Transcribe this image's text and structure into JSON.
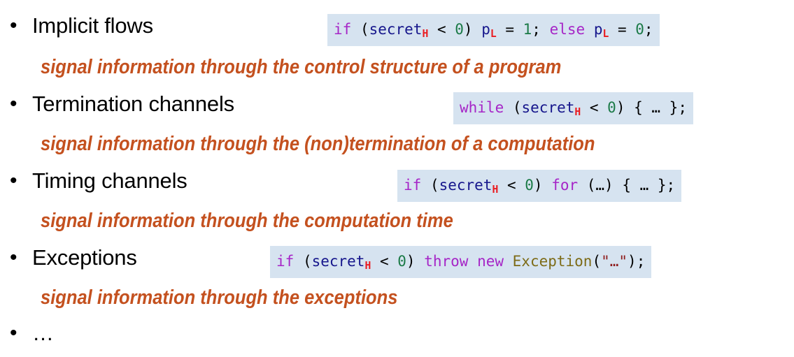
{
  "slide": {
    "background_color": "#ffffff",
    "bullet_glyph": "•",
    "text_color": "#000000",
    "description_color": "#c4511f",
    "code_highlight_color": "#d6e3f0",
    "syntax_colors": {
      "keyword": "#a626c7",
      "identifier": "#16168c",
      "number": "#1b7a47",
      "class": "#7d6b17",
      "string": "#8e1b1b",
      "subscript": "#ea1c21",
      "punctuation": "#000000"
    }
  },
  "bullets": [
    {
      "label": "Implicit flows",
      "description": "signal information through the control structure of a program",
      "code_plain": "if (secretH < 0) pL = 1; else pL = 0;"
    },
    {
      "label": "Termination channels",
      "description": "signal information through the (non)termination of a computation",
      "code_plain": "while (secretH < 0) { … };"
    },
    {
      "label": "Timing channels",
      "description": "signal information through the computation time",
      "code_plain": "if (secretH < 0) for (…) { … };"
    },
    {
      "label": "Exceptions",
      "description": "signal information through the exceptions",
      "code_plain": "if (secretH < 0) throw new Exception(\"…\");"
    },
    {
      "label": "…",
      "description": "",
      "code_plain": ""
    }
  ],
  "code_tokens": {
    "implicit_flows": [
      {
        "t": "if",
        "c": "kw"
      },
      {
        "t": " (",
        "c": "pun"
      },
      {
        "t": "secret",
        "c": "id",
        "sub": "H"
      },
      {
        "t": " < ",
        "c": "pun"
      },
      {
        "t": "0",
        "c": "num"
      },
      {
        "t": ") ",
        "c": "pun"
      },
      {
        "t": "p",
        "c": "id",
        "sub": "L"
      },
      {
        "t": " = ",
        "c": "pun"
      },
      {
        "t": "1",
        "c": "num"
      },
      {
        "t": "; ",
        "c": "pun"
      },
      {
        "t": "else",
        "c": "kw"
      },
      {
        "t": " ",
        "c": "pun"
      },
      {
        "t": "p",
        "c": "id",
        "sub": "L"
      },
      {
        "t": " = ",
        "c": "pun"
      },
      {
        "t": "0",
        "c": "num"
      },
      {
        "t": ";",
        "c": "pun"
      }
    ],
    "termination_channels": [
      {
        "t": "while",
        "c": "kw"
      },
      {
        "t": " (",
        "c": "pun"
      },
      {
        "t": "secret",
        "c": "id",
        "sub": "H"
      },
      {
        "t": " < ",
        "c": "pun"
      },
      {
        "t": "0",
        "c": "num"
      },
      {
        "t": ") { … };",
        "c": "pun"
      }
    ],
    "timing_channels": [
      {
        "t": "if",
        "c": "kw"
      },
      {
        "t": " (",
        "c": "pun"
      },
      {
        "t": "secret",
        "c": "id",
        "sub": "H"
      },
      {
        "t": " < ",
        "c": "pun"
      },
      {
        "t": "0",
        "c": "num"
      },
      {
        "t": ") ",
        "c": "pun"
      },
      {
        "t": "for",
        "c": "kw"
      },
      {
        "t": " (…) { … };",
        "c": "pun"
      }
    ],
    "exceptions": [
      {
        "t": "if",
        "c": "kw"
      },
      {
        "t": " (",
        "c": "pun"
      },
      {
        "t": "secret",
        "c": "id",
        "sub": "H"
      },
      {
        "t": " < ",
        "c": "pun"
      },
      {
        "t": "0",
        "c": "num"
      },
      {
        "t": ") ",
        "c": "pun"
      },
      {
        "t": "throw",
        "c": "kw"
      },
      {
        "t": " ",
        "c": "pun"
      },
      {
        "t": "new",
        "c": "kw"
      },
      {
        "t": " ",
        "c": "pun"
      },
      {
        "t": "Exception",
        "c": "cls"
      },
      {
        "t": "(",
        "c": "pun"
      },
      {
        "t": "\"…\"",
        "c": "str"
      },
      {
        "t": ");",
        "c": "pun"
      }
    ]
  }
}
